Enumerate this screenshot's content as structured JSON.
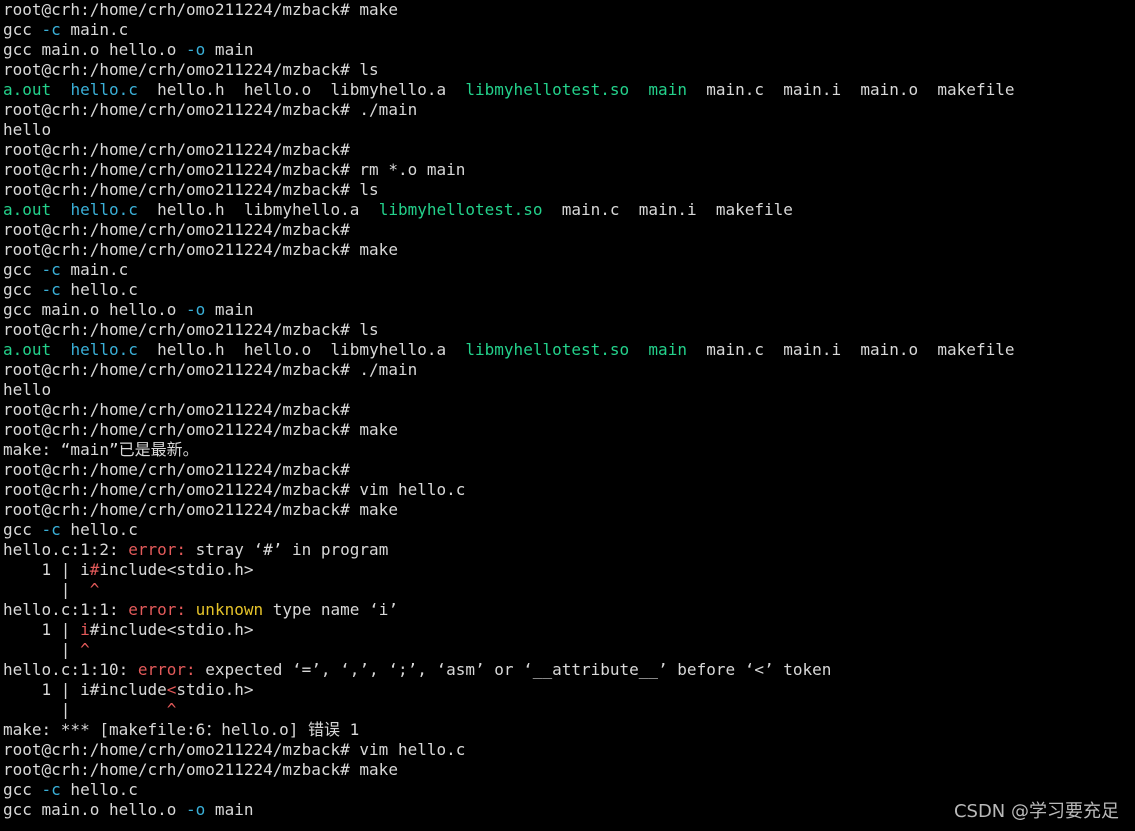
{
  "terminal": {
    "background": "#000000",
    "colors": {
      "normal": "#d8d8d8",
      "cyan": "#3ab0d8",
      "green": "#23d18b",
      "red": "#e35a5a",
      "yellow": "#e5c32a"
    },
    "lines": [
      [
        {
          "t": "root@crh:/home/crh/omo211224/mzback# make",
          "c": "normal"
        }
      ],
      [
        {
          "t": "gcc ",
          "c": "normal"
        },
        {
          "t": "-c",
          "c": "cyan"
        },
        {
          "t": " main.c",
          "c": "normal"
        }
      ],
      [
        {
          "t": "gcc main.o hello.o ",
          "c": "normal"
        },
        {
          "t": "-o",
          "c": "cyan"
        },
        {
          "t": " main",
          "c": "normal"
        }
      ],
      [
        {
          "t": "root@crh:/home/crh/omo211224/mzback# ls",
          "c": "normal"
        }
      ],
      [
        {
          "t": "a.out",
          "c": "green"
        },
        {
          "t": "  ",
          "c": "normal"
        },
        {
          "t": "hello.c",
          "c": "cyan"
        },
        {
          "t": "  hello.h  hello.o  libmyhello.a  ",
          "c": "normal"
        },
        {
          "t": "libmyhellotest.so",
          "c": "green"
        },
        {
          "t": "  ",
          "c": "normal"
        },
        {
          "t": "main",
          "c": "green"
        },
        {
          "t": "  main.c  main.i  main.o  makefile",
          "c": "normal"
        }
      ],
      [
        {
          "t": "root@crh:/home/crh/omo211224/mzback# ./main",
          "c": "normal"
        }
      ],
      [
        {
          "t": "hello",
          "c": "normal"
        }
      ],
      [
        {
          "t": "root@crh:/home/crh/omo211224/mzback#",
          "c": "normal"
        }
      ],
      [
        {
          "t": "root@crh:/home/crh/omo211224/mzback# rm *.o main",
          "c": "normal"
        }
      ],
      [
        {
          "t": "root@crh:/home/crh/omo211224/mzback# ls",
          "c": "normal"
        }
      ],
      [
        {
          "t": "a.out",
          "c": "green"
        },
        {
          "t": "  ",
          "c": "normal"
        },
        {
          "t": "hello.c",
          "c": "cyan"
        },
        {
          "t": "  hello.h  libmyhello.a  ",
          "c": "normal"
        },
        {
          "t": "libmyhellotest.so",
          "c": "green"
        },
        {
          "t": "  main.c  main.i  makefile",
          "c": "normal"
        }
      ],
      [
        {
          "t": "root@crh:/home/crh/omo211224/mzback#",
          "c": "normal"
        }
      ],
      [
        {
          "t": "root@crh:/home/crh/omo211224/mzback# make",
          "c": "normal"
        }
      ],
      [
        {
          "t": "gcc ",
          "c": "normal"
        },
        {
          "t": "-c",
          "c": "cyan"
        },
        {
          "t": " main.c",
          "c": "normal"
        }
      ],
      [
        {
          "t": "gcc ",
          "c": "normal"
        },
        {
          "t": "-c",
          "c": "cyan"
        },
        {
          "t": " hello.c",
          "c": "normal"
        }
      ],
      [
        {
          "t": "gcc main.o hello.o ",
          "c": "normal"
        },
        {
          "t": "-o",
          "c": "cyan"
        },
        {
          "t": " main",
          "c": "normal"
        }
      ],
      [
        {
          "t": "root@crh:/home/crh/omo211224/mzback# ls",
          "c": "normal"
        }
      ],
      [
        {
          "t": "a.out",
          "c": "green"
        },
        {
          "t": "  ",
          "c": "normal"
        },
        {
          "t": "hello.c",
          "c": "cyan"
        },
        {
          "t": "  hello.h  hello.o  libmyhello.a  ",
          "c": "normal"
        },
        {
          "t": "libmyhellotest.so",
          "c": "green"
        },
        {
          "t": "  ",
          "c": "normal"
        },
        {
          "t": "main",
          "c": "green"
        },
        {
          "t": "  main.c  main.i  main.o  makefile",
          "c": "normal"
        }
      ],
      [
        {
          "t": "root@crh:/home/crh/omo211224/mzback# ./main",
          "c": "normal"
        }
      ],
      [
        {
          "t": "hello",
          "c": "normal"
        }
      ],
      [
        {
          "t": "root@crh:/home/crh/omo211224/mzback#",
          "c": "normal"
        }
      ],
      [
        {
          "t": "root@crh:/home/crh/omo211224/mzback# make",
          "c": "normal"
        }
      ],
      [
        {
          "t": "make: “main”已是最新。",
          "c": "normal"
        }
      ],
      [
        {
          "t": "root@crh:/home/crh/omo211224/mzback#",
          "c": "normal"
        }
      ],
      [
        {
          "t": "root@crh:/home/crh/omo211224/mzback# vim hello.c",
          "c": "normal"
        }
      ],
      [
        {
          "t": "root@crh:/home/crh/omo211224/mzback# make",
          "c": "normal"
        }
      ],
      [
        {
          "t": "gcc ",
          "c": "normal"
        },
        {
          "t": "-c",
          "c": "cyan"
        },
        {
          "t": " hello.c",
          "c": "normal"
        }
      ],
      [
        {
          "t": "hello.c:1:2: ",
          "c": "normal"
        },
        {
          "t": "error:",
          "c": "red"
        },
        {
          "t": " stray ‘#’ in program",
          "c": "normal"
        }
      ],
      [
        {
          "t": "    1 | i",
          "c": "normal"
        },
        {
          "t": "#",
          "c": "red"
        },
        {
          "t": "include<stdio.h>",
          "c": "normal"
        }
      ],
      [
        {
          "t": "      |  ",
          "c": "normal"
        },
        {
          "t": "^",
          "c": "red"
        }
      ],
      [
        {
          "t": "hello.c:1:1: ",
          "c": "normal"
        },
        {
          "t": "error:",
          "c": "red"
        },
        {
          "t": " ",
          "c": "normal"
        },
        {
          "t": "unknown",
          "c": "yellow"
        },
        {
          "t": " type name ‘i’",
          "c": "normal"
        }
      ],
      [
        {
          "t": "    1 | ",
          "c": "normal"
        },
        {
          "t": "i",
          "c": "red"
        },
        {
          "t": "#include<stdio.h>",
          "c": "normal"
        }
      ],
      [
        {
          "t": "      | ",
          "c": "normal"
        },
        {
          "t": "^",
          "c": "red"
        }
      ],
      [
        {
          "t": "hello.c:1:10: ",
          "c": "normal"
        },
        {
          "t": "error:",
          "c": "red"
        },
        {
          "t": " expected ‘=’, ‘,’, ‘;’, ‘asm’ or ‘__attribute__’ before ‘<’ token",
          "c": "normal"
        }
      ],
      [
        {
          "t": "    1 | i#include",
          "c": "normal"
        },
        {
          "t": "<",
          "c": "red"
        },
        {
          "t": "stdio.h>",
          "c": "normal"
        }
      ],
      [
        {
          "t": "      |          ",
          "c": "normal"
        },
        {
          "t": "^",
          "c": "red"
        }
      ],
      [
        {
          "t": "make: *** [makefile:6：hello.o] 错误 1",
          "c": "normal"
        }
      ],
      [
        {
          "t": "root@crh:/home/crh/omo211224/mzback# vim hello.c",
          "c": "normal"
        }
      ],
      [
        {
          "t": "root@crh:/home/crh/omo211224/mzback# make",
          "c": "normal"
        }
      ],
      [
        {
          "t": "gcc ",
          "c": "normal"
        },
        {
          "t": "-c",
          "c": "cyan"
        },
        {
          "t": " hello.c",
          "c": "normal"
        }
      ],
      [
        {
          "t": "gcc main.o hello.o ",
          "c": "normal"
        },
        {
          "t": "-o",
          "c": "cyan"
        },
        {
          "t": " main",
          "c": "normal"
        }
      ]
    ]
  },
  "watermark": {
    "text": "CSDN @学习要充足"
  }
}
